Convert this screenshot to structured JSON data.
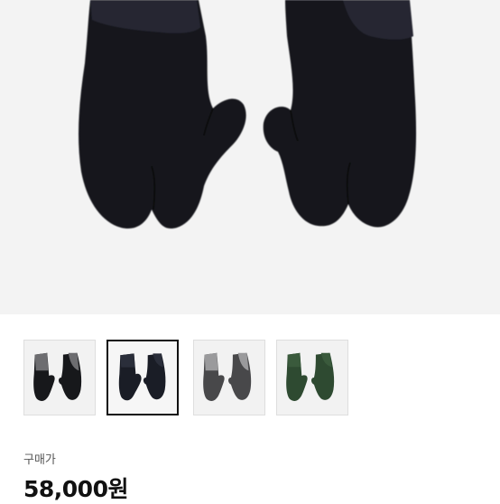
{
  "product": {
    "main_image_icon": "black-fleece-mittens-photo",
    "thumbnails": [
      {
        "icon": "black-mittens-grey-cuff-photo",
        "selected": false
      },
      {
        "icon": "navy-mittens-photo",
        "selected": true
      },
      {
        "icon": "charcoal-mittens-grey-cuff-photo",
        "selected": false
      },
      {
        "icon": "green-mittens-photo",
        "selected": false
      }
    ]
  },
  "price": {
    "label": "구매가",
    "value": "58,000원"
  },
  "colors": {
    "mitten_main": "#15171c",
    "mitten_patch": "#25272f",
    "hero_bg": "#f3f3f3",
    "green": "#2f4a32",
    "charcoal": "#4a4a4c"
  }
}
